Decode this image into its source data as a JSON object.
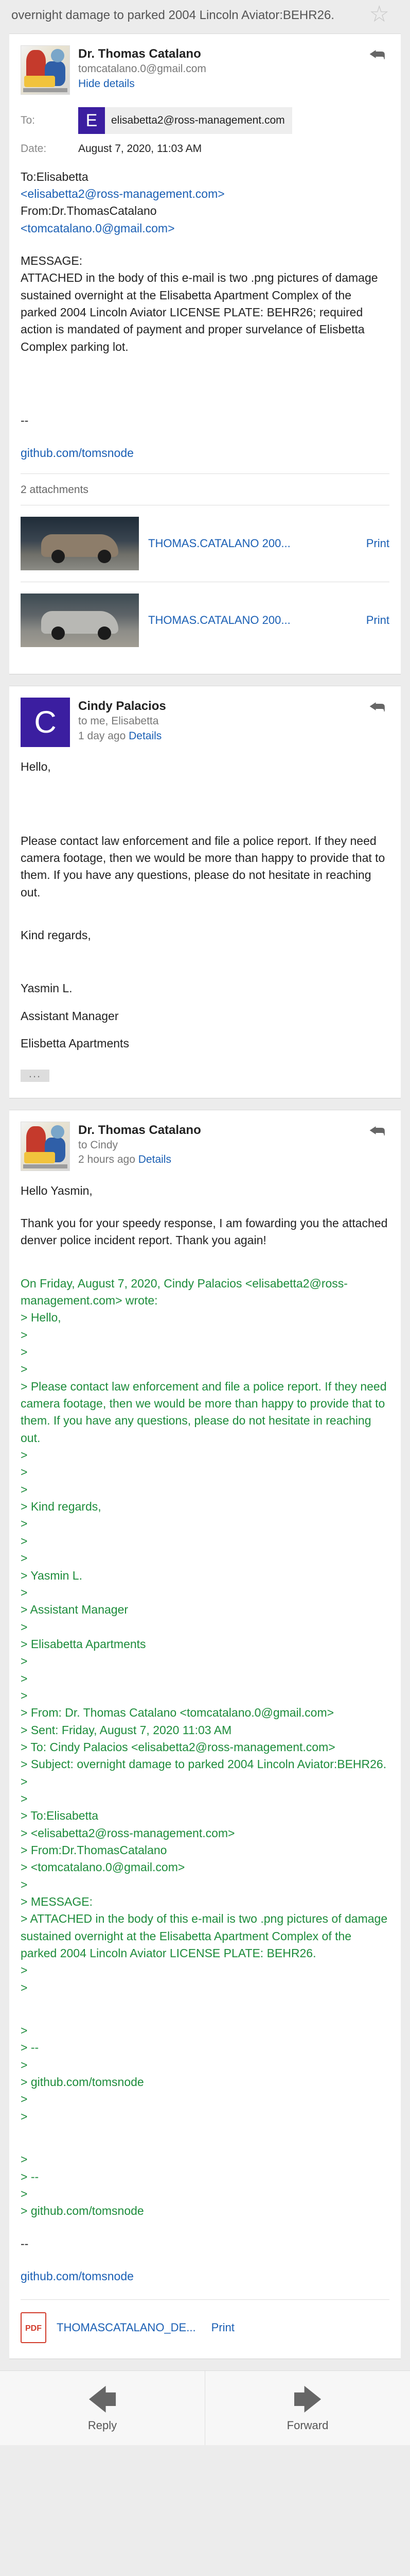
{
  "subject": "overnight damage to parked 2004 Lincoln Aviator:BEHR26.",
  "msg1": {
    "sender_name": "Dr. Thomas Catalano",
    "sender_email": "tomcatalano.0@gmail.com",
    "hide_details": "Hide details",
    "to_label": "To:",
    "to_initial": "E",
    "to_email": "elisabetta2@ross-management.com",
    "date_label": "Date:",
    "date": "August 7, 2020, 11:03 AM",
    "body": {
      "line1": "To:Elisabetta",
      "line2_link": "<elisabetta2@ross-management.com>",
      "line3": "From:Dr.ThomasCatalano",
      "line4_link": "<tomcatalano.0@gmail.com>",
      "message_heading": "MESSAGE:",
      "message_text": "ATTACHED in the body of this e-mail is two .png pictures of damage sustained overnight at the Elisabetta Apartment Complex of the parked 2004 Lincoln Aviator LICENSE PLATE: BEHR26; required action is mandated of payment and proper survelance of Elisbetta Complex parking lot.",
      "dashes": "--",
      "github": "github.com/tomsnode"
    },
    "attachments_count": "2 attachments",
    "attachments": [
      {
        "name": "THOMAS.CATALANO 200...",
        "print": "Print"
      },
      {
        "name": "THOMAS.CATALANO 200...",
        "print": "Print"
      }
    ]
  },
  "msg2": {
    "initial": "C",
    "sender_name": "Cindy Palacios",
    "to_line": "to me, Elisabetta",
    "time": "1 day ago",
    "details": "Details",
    "greeting": "Hello,",
    "body": "Please contact law enforcement and file a police report. If they need camera footage, then we would be more than happy to provide that to them. If you have any questions, please do not hesitate in reaching out.",
    "closing": "Kind regards,",
    "sig_name": "Yasmin L.",
    "sig_title": "Assistant Manager",
    "sig_org": "Elisbetta Apartments",
    "more": "..."
  },
  "msg3": {
    "sender_name": "Dr. Thomas Catalano",
    "to_line": "to Cindy",
    "time": "2 hours ago",
    "details": "Details",
    "greeting": "Hello Yasmin,",
    "body": "Thank you for your speedy response, I am fowarding you the attached denver police incident report. Thank you again!",
    "quote_intro": "On Friday, August 7, 2020, Cindy Palacios <elisabetta2@ross-management.com> wrote:",
    "q_hello": "> Hello,",
    "q_blank": ">",
    "q_body": "> Please contact law enforcement and file a police report. If they need camera footage, then we would be more than happy to provide that to them. If you have any questions, please do not hesitate in reaching out.",
    "q_kind": "> Kind regards,",
    "q_yasmin": "> Yasmin L.",
    "q_asst": "> Assistant Manager",
    "q_org": "> Elisabetta Apartments",
    "q_from": "> From: Dr. Thomas Catalano <tomcatalano.0@gmail.com>",
    "q_sent": "> Sent: Friday, August 7, 2020 11:03 AM",
    "q_to": "> To: Cindy Palacios <elisabetta2@ross-management.com>",
    "q_subject": "> Subject: overnight damage to parked 2004 Lincoln Aviator:BEHR26.",
    "q_to_elis": "> To:Elisabetta",
    "q_elis_email": "> <elisabetta2@ross-management.com>",
    "q_from2": "> From:Dr.ThomasCatalano",
    "q_tom_email": "> <tomcatalano.0@gmail.com>",
    "q_message": "> MESSAGE:",
    "q_attached": "> ATTACHED in the body of this e-mail is two .png pictures of damage sustained overnight at the Elisabetta Apartment Complex of the parked 2004 Lincoln Aviator LICENSE PLATE: BEHR26.",
    "q_dashes": "> --",
    "q_github": "> github.com/tomsnode",
    "dashes": "--",
    "github": "github.com/tomsnode",
    "pdf_label": "PDF",
    "pdf_name": "THOMASCATALANO_DE...",
    "print": "Print"
  },
  "actions": {
    "reply": "Reply",
    "forward": "Forward"
  }
}
